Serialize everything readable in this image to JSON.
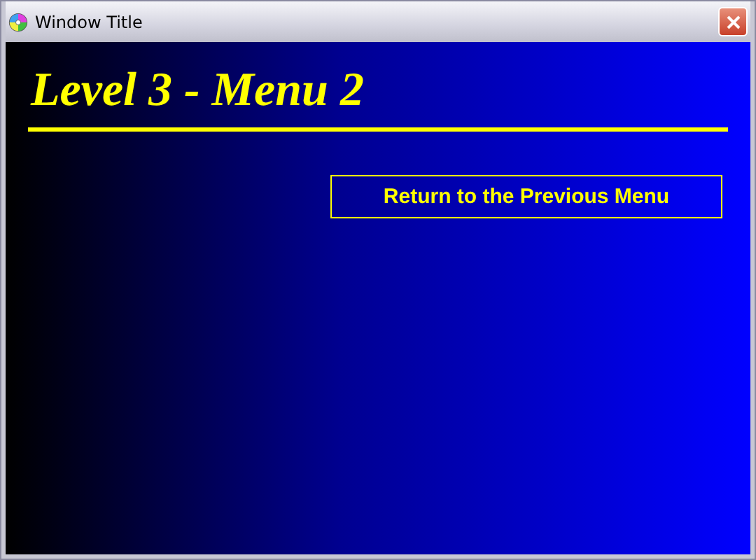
{
  "window": {
    "title": "Window Title"
  },
  "heading": "Level 3 - Menu 2",
  "buttons": [
    {
      "label": "Return to the Previous Menu"
    }
  ]
}
